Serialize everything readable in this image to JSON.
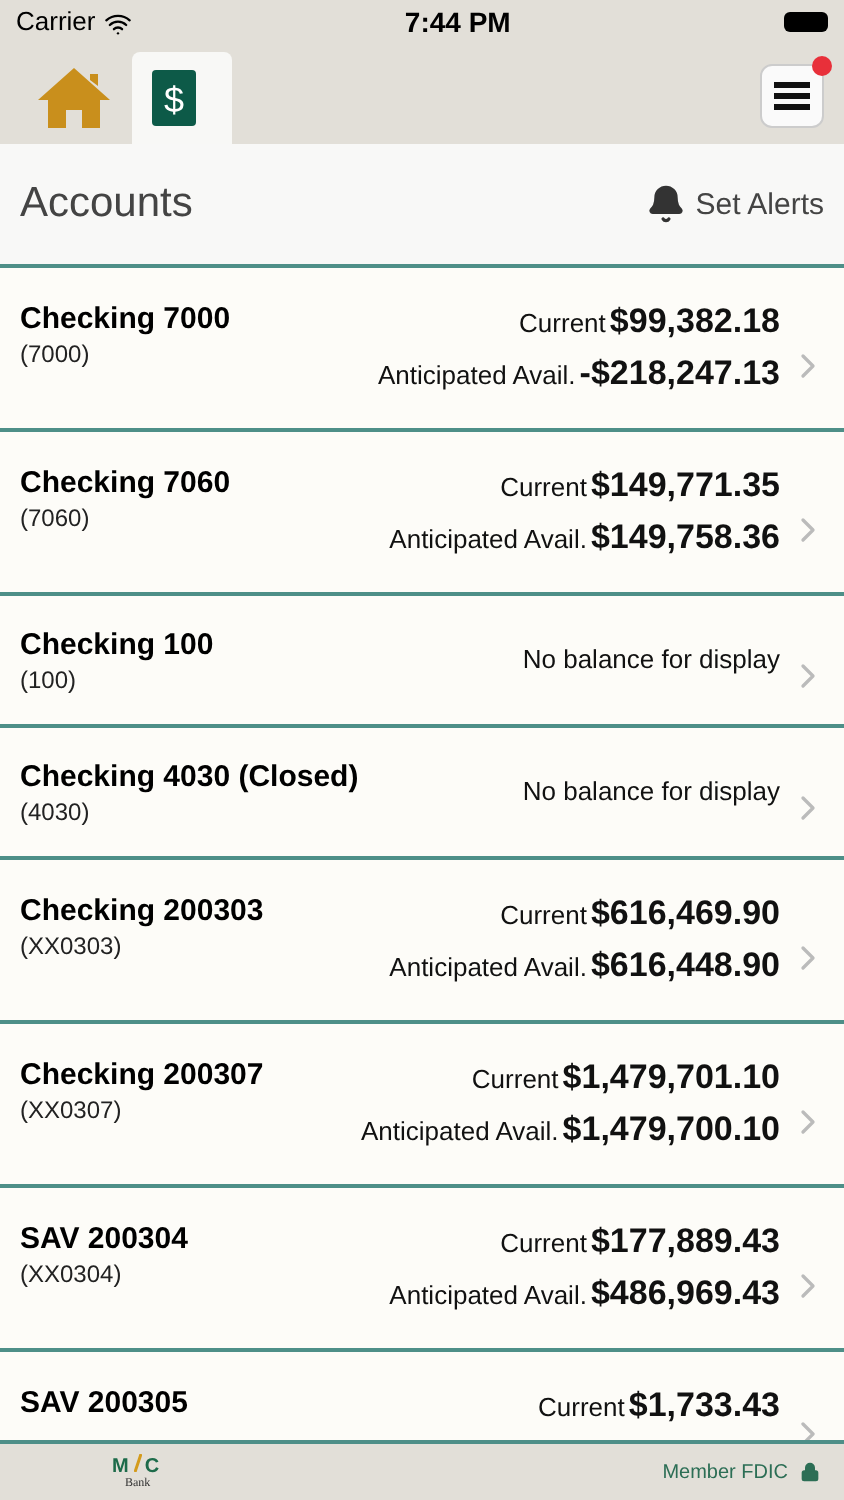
{
  "status_bar": {
    "carrier": "Carrier",
    "time": "7:44 PM"
  },
  "tabs": [
    {
      "kind": "home",
      "selected": false
    },
    {
      "kind": "accounts",
      "selected": true,
      "glyph": "$"
    }
  ],
  "menu": {
    "has_notification": true
  },
  "header": {
    "title": "Accounts",
    "alerts_label": "Set Alerts"
  },
  "accounts": [
    {
      "kind": "balances",
      "name": "Checking 7000",
      "number": "(7000)",
      "current_label": "Current",
      "current": "$99,382.18",
      "anticipated_label": "Anticipated Avail.",
      "anticipated": "-$218,247.13"
    },
    {
      "kind": "balances",
      "name": "Checking 7060",
      "number": "(7060)",
      "current_label": "Current",
      "current": "$149,771.35",
      "anticipated_label": "Anticipated Avail.",
      "anticipated": "$149,758.36"
    },
    {
      "kind": "none",
      "name": "Checking 100",
      "number": "(100)",
      "message": "No balance for display"
    },
    {
      "kind": "none",
      "name": "Checking 4030 (Closed)",
      "number": "(4030)",
      "message": "No balance for display"
    },
    {
      "kind": "balances",
      "name": "Checking 200303",
      "number": "(XX0303)",
      "current_label": "Current",
      "current": "$616,469.90",
      "anticipated_label": "Anticipated Avail.",
      "anticipated": "$616,448.90"
    },
    {
      "kind": "balances",
      "name": "Checking 200307",
      "number": "(XX0307)",
      "current_label": "Current",
      "current": "$1,479,701.10",
      "anticipated_label": "Anticipated Avail.",
      "anticipated": "$1,479,700.10"
    },
    {
      "kind": "balances",
      "name": "SAV 200304",
      "number": "(XX0304)",
      "current_label": "Current",
      "current": "$177,889.43",
      "anticipated_label": "Anticipated Avail.",
      "anticipated": "$486,969.43"
    },
    {
      "kind": "partial",
      "name": "SAV 200305",
      "current_label": "Current",
      "current": "$1,733.43"
    }
  ],
  "footer": {
    "logo_letters": [
      "M",
      "C"
    ],
    "logo_subtitle": "Bank",
    "member": "Member FDIC"
  }
}
